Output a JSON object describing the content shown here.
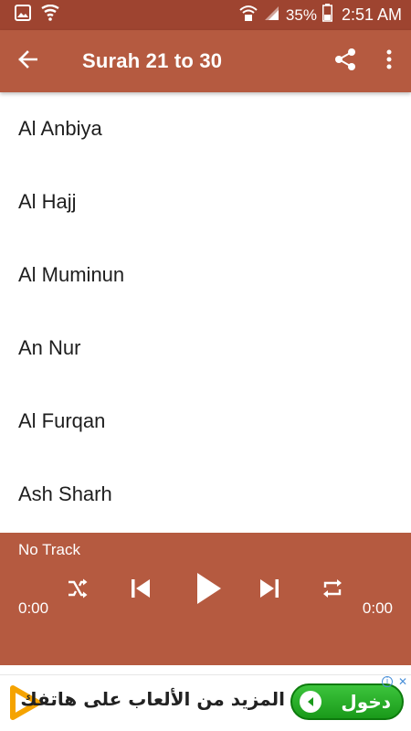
{
  "status_bar": {
    "battery_percent": "35%",
    "time": "2:51 AM",
    "icons": [
      "image-notification-icon",
      "shield-notification-icon",
      "wifi-calling-icon",
      "signal-icon",
      "battery-icon"
    ]
  },
  "app_bar": {
    "title": "Surah 21 to 30",
    "back_icon": "arrow-back-icon",
    "share_icon": "share-icon",
    "menu_icon": "more-vert-icon"
  },
  "surahs": [
    {
      "label": "Al Anbiya"
    },
    {
      "label": "Al Hajj"
    },
    {
      "label": "Al Muminun"
    },
    {
      "label": "An Nur"
    },
    {
      "label": "Al Furqan"
    },
    {
      "label": "Ash Sharh"
    }
  ],
  "player": {
    "track": "No Track",
    "current_time": "0:00",
    "total_time": "0:00",
    "controls": [
      "shuffle-icon",
      "skip-previous-icon",
      "play-icon",
      "skip-next-icon",
      "repeat-icon"
    ]
  },
  "ad": {
    "text": "المزيد من الألعاب على هاتفك",
    "cta": "دخول",
    "info_icon": "info-icon",
    "close_icon": "close-icon",
    "logo": "play-logo-icon"
  },
  "colors": {
    "status_bar": "#9e4430",
    "primary": "#b55a40",
    "ad_button": "#22aa22"
  }
}
